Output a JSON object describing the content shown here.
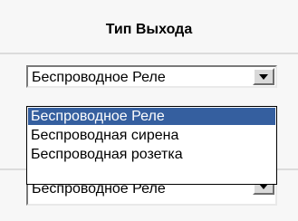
{
  "header": {
    "title": "Тип Выхода"
  },
  "combo_top": {
    "value": "Беспроводное Реле"
  },
  "dropdown": {
    "options": [
      {
        "label": "Беспроводное Реле",
        "selected": true
      },
      {
        "label": "Беспроводная сирена",
        "selected": false
      },
      {
        "label": "Беспроводная розетка",
        "selected": false
      }
    ]
  },
  "combo_bottom": {
    "value": "Беспроводное Реле"
  }
}
